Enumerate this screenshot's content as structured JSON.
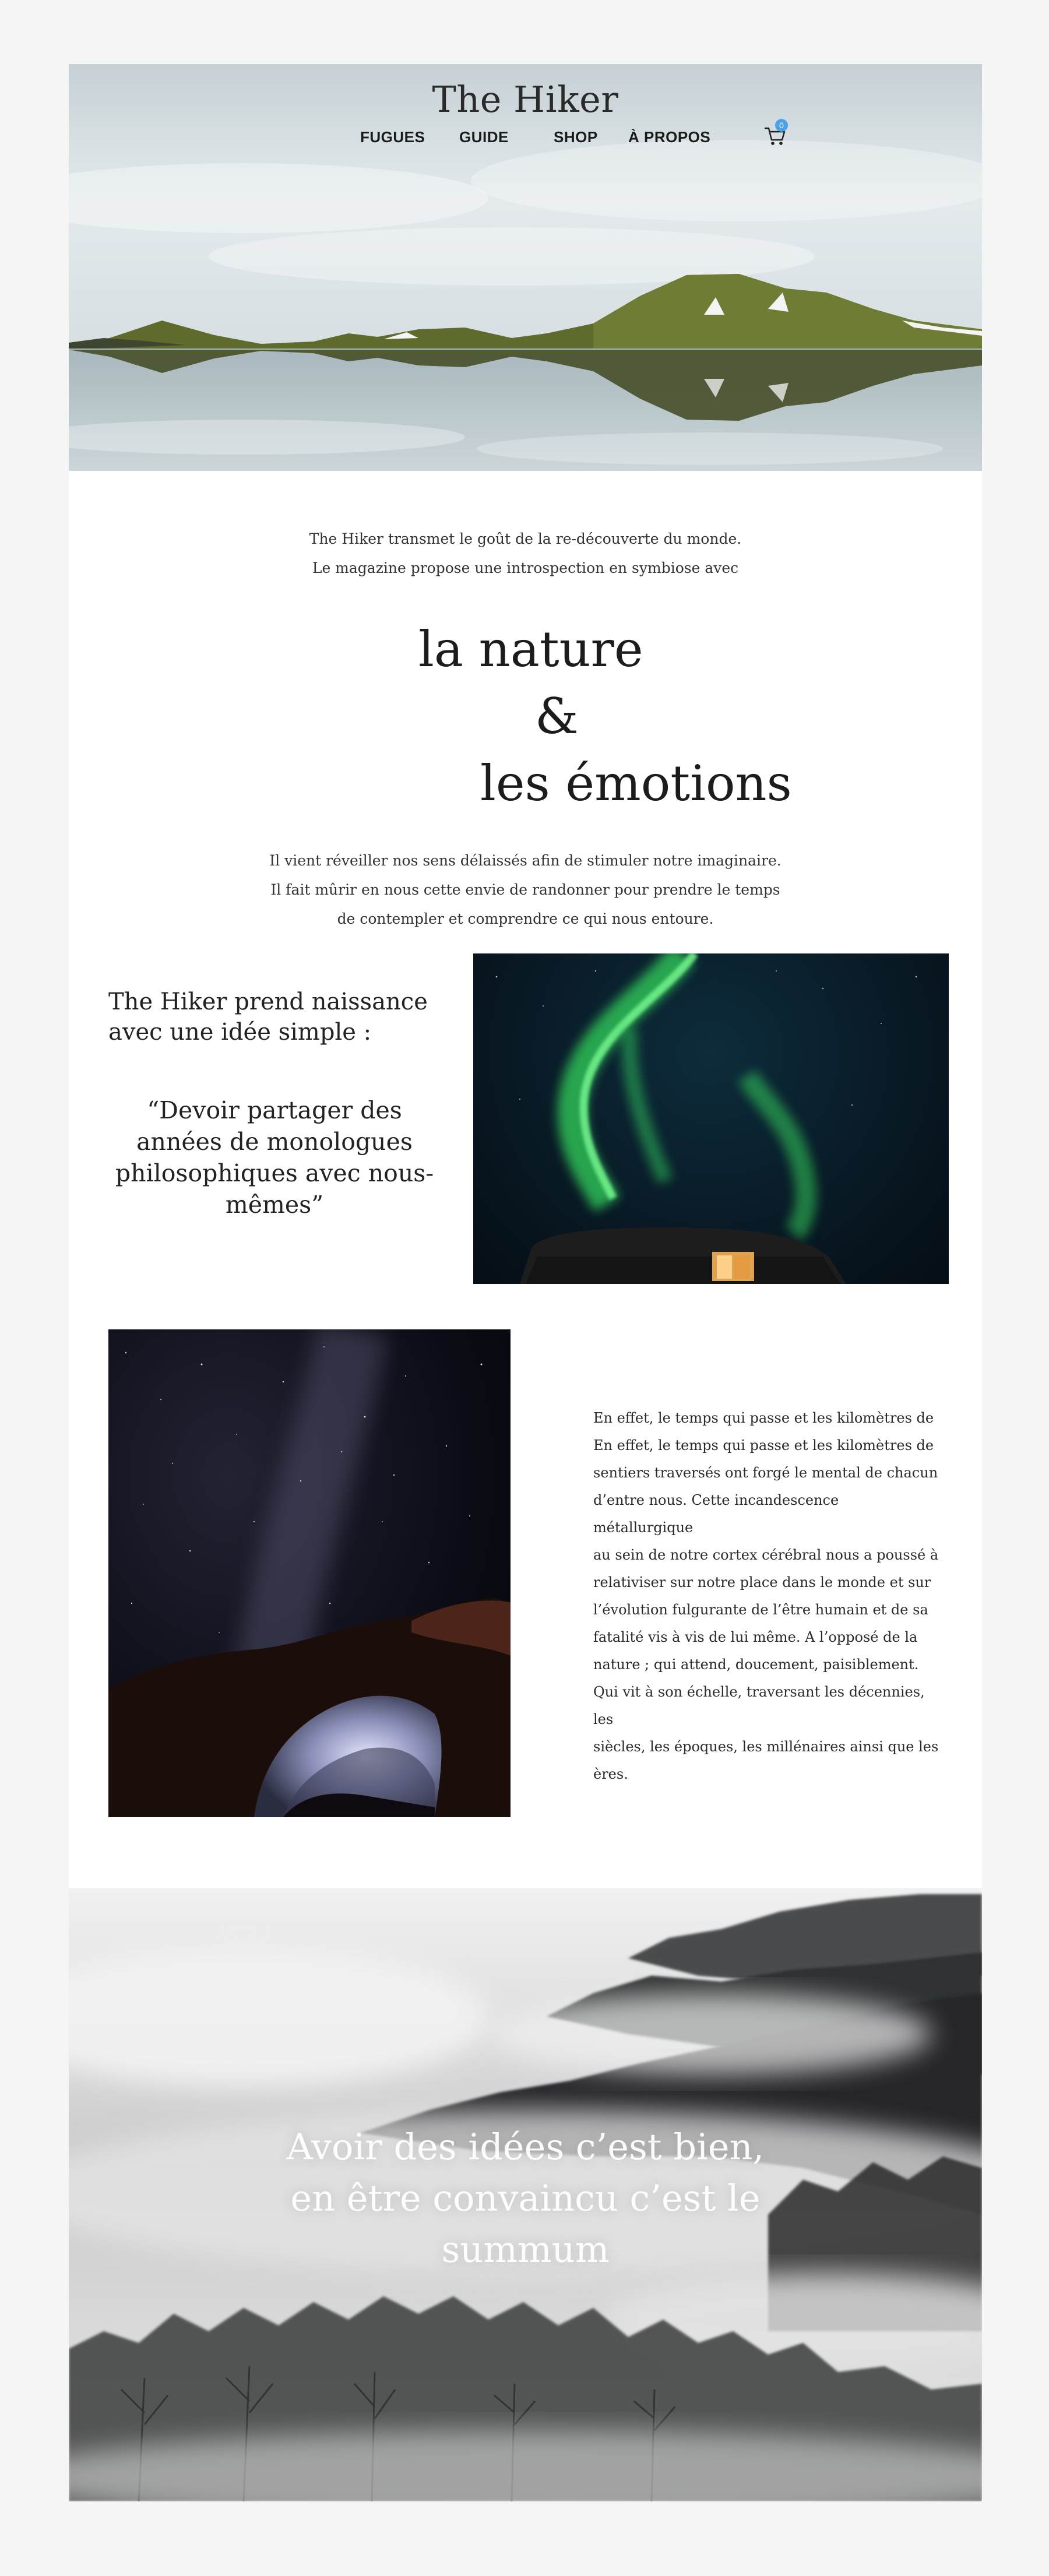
{
  "header": {
    "brand": "The Hiker",
    "nav": [
      "FUGUES",
      "GUIDE",
      "SHOP",
      "À PROPOS"
    ],
    "cart_icon": "cart-icon",
    "cart_count": "0"
  },
  "intro": {
    "lines": [
      "The Hiker transmet le goût de la re-découverte du monde.",
      "Le magazine propose une introspection en symbiose avec"
    ],
    "highlight": [
      "la nature",
      "&",
      "les émotions"
    ],
    "lines2": [
      "Il vient réveiller nos sens délaissés afin de stimuler notre imaginaire.",
      "Il fait mûrir en nous cette envie de randonner pour prendre le temps",
      "de contempler et comprendre ce qui nous entoure."
    ]
  },
  "section1": {
    "lead": "The Hiker prend naissance avec une idée simple :",
    "quote": "“Devoir partager des années de monologues philosophiques avec nous-mêmes”"
  },
  "section2": {
    "lines": [
      "En effet, le temps qui passe et les kilomètres de",
      "En effet, le temps qui passe et les kilomètres de",
      "sentiers traversés ont forgé le mental de chacun",
      "d’entre nous. Cette incandescence métallurgique",
      "au sein de notre cortex cérébral nous a poussé à",
      "relativiser sur notre place dans le monde et sur",
      "l’évolution fulgurante de l’être humain et de sa",
      "fatalité vis à vis de lui même. A l’opposé de la",
      "nature ; qui attend, doucement, paisiblement.",
      "Qui vit à son échelle, traversant les décennies, les",
      "siècles, les époques, les millénaires ainsi que les",
      "ères."
    ]
  },
  "fog": {
    "lines": [
      "Avoir des idées c’est bien,",
      "en être convaincu c’est le",
      "summum"
    ]
  },
  "colors": {
    "background": "#f5f5f5",
    "page": "#ffffff",
    "text": "#1a1a1a",
    "badge": "#4aa3e8",
    "aurora": "#33d35a"
  }
}
